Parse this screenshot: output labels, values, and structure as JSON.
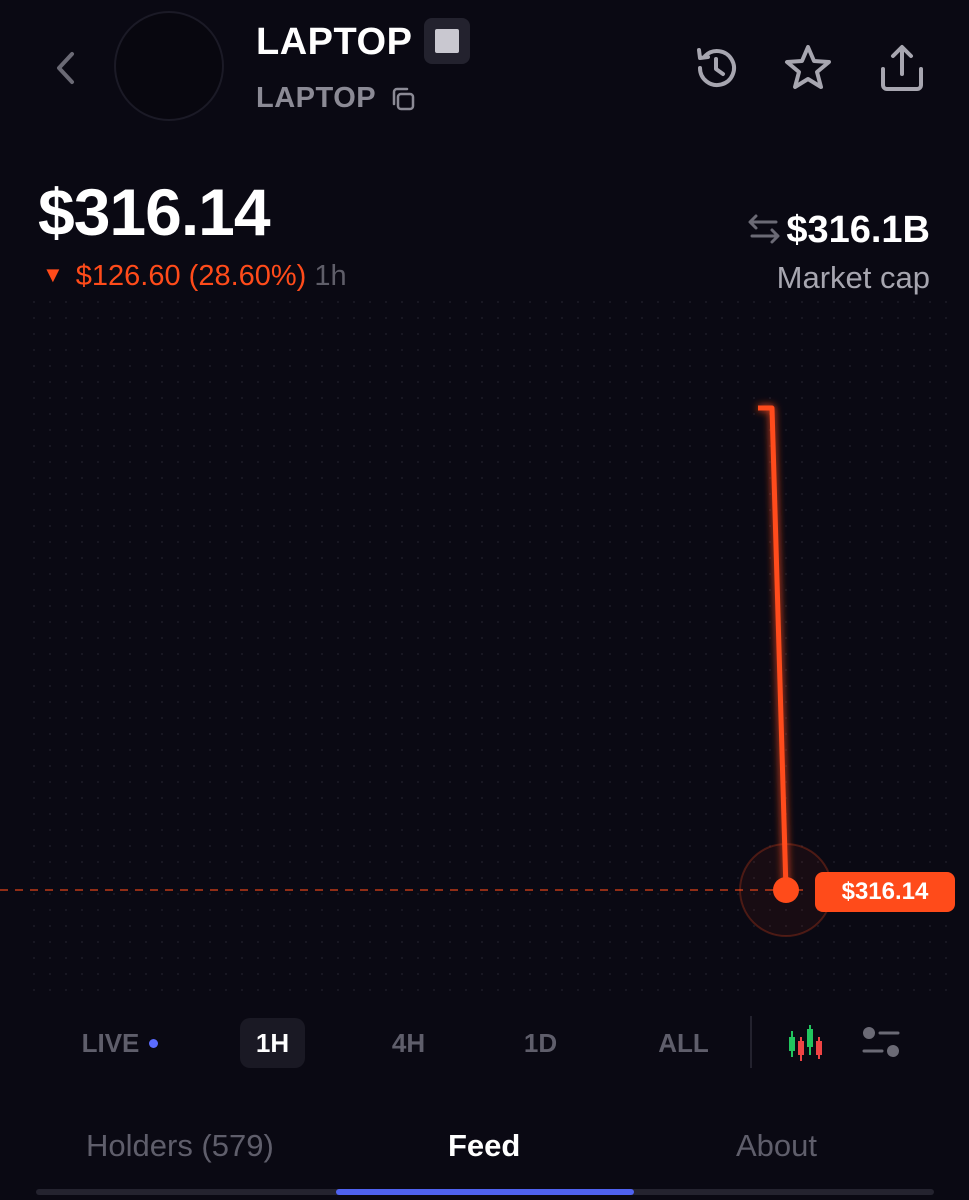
{
  "header": {
    "token_name": "LAPTOP",
    "token_ticker": "LAPTOP",
    "icons": [
      "back-chevron-icon",
      "copy-icon",
      "history-icon",
      "star-icon",
      "share-icon"
    ]
  },
  "price": {
    "current": "$316.14",
    "change_value": "$126.60 (28.60%)",
    "change_direction": "▼",
    "change_period": "1h",
    "market_cap": "$316.1B",
    "market_cap_label": "Market cap"
  },
  "chart_data": {
    "type": "line",
    "current_price_label": "$316.14",
    "points": [
      {
        "x": 0,
        "y": 442.74
      },
      {
        "x": 1,
        "y": 442.74
      },
      {
        "x": 2,
        "y": 316.14
      }
    ],
    "line_color": "#ff4b1a",
    "grid": "dots",
    "reference_line": "dashed at current price"
  },
  "timeframes": {
    "items": [
      {
        "label": "LIVE",
        "active": false
      },
      {
        "label": "1H",
        "active": true
      },
      {
        "label": "4H",
        "active": false
      },
      {
        "label": "1D",
        "active": false
      },
      {
        "label": "ALL",
        "active": false
      }
    ],
    "tools": [
      "candlestick-icon",
      "chart-settings-icon"
    ]
  },
  "tabs": [
    {
      "label": "Holders (579)",
      "active": false
    },
    {
      "label": "Feed",
      "active": true
    },
    {
      "label": "About",
      "active": false
    }
  ],
  "colors": {
    "background": "#0a0913",
    "accent_red": "#ff4b1a",
    "accent_blue": "#4f62f0",
    "muted_text": "#5f5e6b"
  }
}
